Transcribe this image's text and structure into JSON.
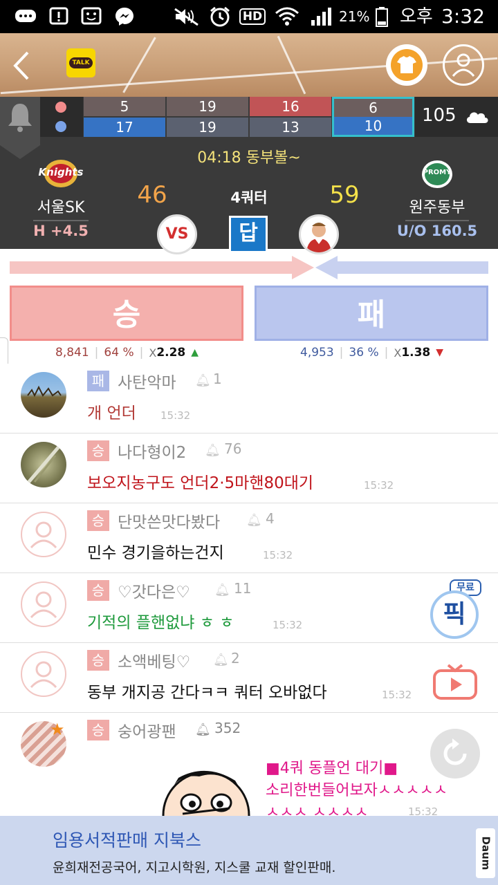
{
  "status_bar": {
    "battery": "21%",
    "ampm": "오후",
    "time": "3:32",
    "hd": "HD"
  },
  "header": {
    "talk_label": "TALK"
  },
  "score": {
    "home_quarters": [
      "5",
      "19",
      "16",
      "6"
    ],
    "away_quarters": [
      "17",
      "19",
      "13",
      "10"
    ],
    "total": "105",
    "status": "04:18 동부볼~",
    "quarter": "4쿼터",
    "home": {
      "name": "서울SK",
      "score": "46",
      "line": "H +4.5",
      "logo": "Knights"
    },
    "away": {
      "name": "원주동부",
      "score": "59",
      "line": "U/O 160.5",
      "logo": "PROMY"
    },
    "vs": "VS",
    "answer": "답"
  },
  "vote": {
    "win_label": "승",
    "lose_label": "패",
    "win_stats": {
      "count": "8,841",
      "pct": "64 %",
      "x": "X",
      "odds": "2.28",
      "arrow": "▲"
    },
    "lose_stats": {
      "count": "4,953",
      "pct": "36 %",
      "x": "X",
      "odds": "1.38",
      "arrow": "▼"
    }
  },
  "colors": {
    "win": "#f2a6a3",
    "lose": "#b8c4ec",
    "win_badge": "#f0aaa7",
    "lose_badge": "#a9b7e6"
  },
  "comments": [
    {
      "badge": "패",
      "user": "사탄악마",
      "likes": "1",
      "text": "개 언더",
      "time": "15:32",
      "color": "#b23a36"
    },
    {
      "badge": "승",
      "user": "나다형이2",
      "likes": "76",
      "text": "보오지농구도 언더2·5마핸80대기",
      "time": "15:32",
      "color": "#c0141b"
    },
    {
      "badge": "승",
      "user": "단맛쓴맛다봤다",
      "likes": "4",
      "text": "민수 경기을하는건지",
      "time": "15:32",
      "color": "#111111"
    },
    {
      "badge": "승",
      "user": "♡갓다은♡",
      "likes": "11",
      "text": "기적의 플핸없냐 ㅎ ㅎ",
      "time": "15:32",
      "color": "#1e9a3c"
    },
    {
      "badge": "승",
      "user": "소액베팅♡",
      "likes": "2",
      "text": "동부 개지공 간다ㅋㅋ 쿼터 오바없다",
      "time": "15:32",
      "color": "#111111"
    },
    {
      "badge": "승",
      "user": "숭어광팬",
      "likes": "352",
      "text_line1": "■4쿼 동플언 대기■",
      "text_line2": "소리한번들어보자ㅅㅅㅅㅅㅅ",
      "text_line3": "ㅅㅅㅅ ㅅㅅㅅㅅ",
      "time": "15:32"
    }
  ],
  "floating": {
    "free_label": "무료",
    "pick_label": "픽"
  },
  "ad": {
    "title": "임용서적판매 지북스",
    "desc": "윤희재전공국어, 지고시학원, 지스쿨 교재 할인판매.",
    "brand": "Daum"
  }
}
